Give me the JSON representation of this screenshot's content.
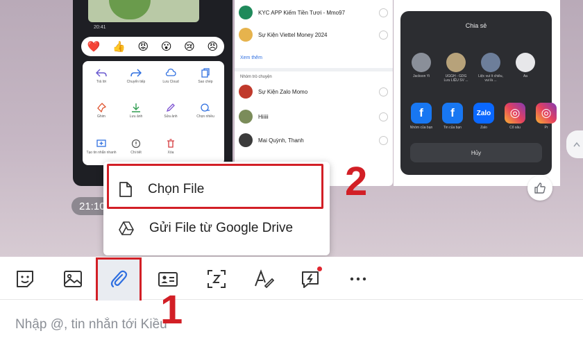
{
  "screens": {
    "first": {
      "time": "20:41",
      "reactions": [
        "❤️",
        "👍",
        "😡",
        "😮",
        "😢",
        "😠"
      ],
      "actions": [
        "Trả lời",
        "Chuyển tiếp",
        "Lưu Cloud",
        "Sao chép",
        "Ghim",
        "Lưu ảnh",
        "Sửa ảnh",
        "Chọn nhiều",
        "Tạo tin nhắn nhanh",
        "Chi tiết",
        "Xóa"
      ]
    },
    "second": {
      "rows_top": [
        "KYC APP Kiếm Tiền Tươi - Mmo97",
        "Sự Kiện Viettel Money 2024"
      ],
      "more_label": "Xem thêm",
      "section_label": "Nhóm trò chuyện",
      "rows_bottom": [
        "Sự Kiện Zalo Momo",
        "Hiiiii",
        "Mai Quỳnh, Thanh"
      ]
    },
    "third": {
      "sheet_title": "Chia sẻ",
      "contacts": [
        "Jackson Yi",
        "UGGH - GDG Lưu LIỆU SV ...",
        "Liệc vui ít chiêu, vui là ...",
        "Aa"
      ],
      "apps": [
        "Nhóm của bạn",
        "Tin của bạn",
        "Zalo",
        "Cổ sâu",
        "Pr"
      ],
      "cancel_label": "Hủy"
    }
  },
  "time_pill": "21:10",
  "popup": {
    "items": [
      {
        "label": "Chọn File",
        "icon": "file-icon"
      },
      {
        "label": "Gửi File từ Google Drive",
        "icon": "google-drive-icon"
      }
    ]
  },
  "annotations": {
    "step1": "1",
    "step2": "2"
  },
  "toolbar": {
    "buttons": [
      "sticker-icon",
      "image-icon",
      "attachment-icon",
      "contact-card-icon",
      "zoom-capture-icon",
      "text-format-icon",
      "quick-message-icon",
      "more-icon"
    ]
  },
  "composer": {
    "placeholder": "Nhập @, tin nhắn tới Kiều"
  },
  "colors": {
    "accent": "#d21f26",
    "brand": "#2f6fe0"
  }
}
